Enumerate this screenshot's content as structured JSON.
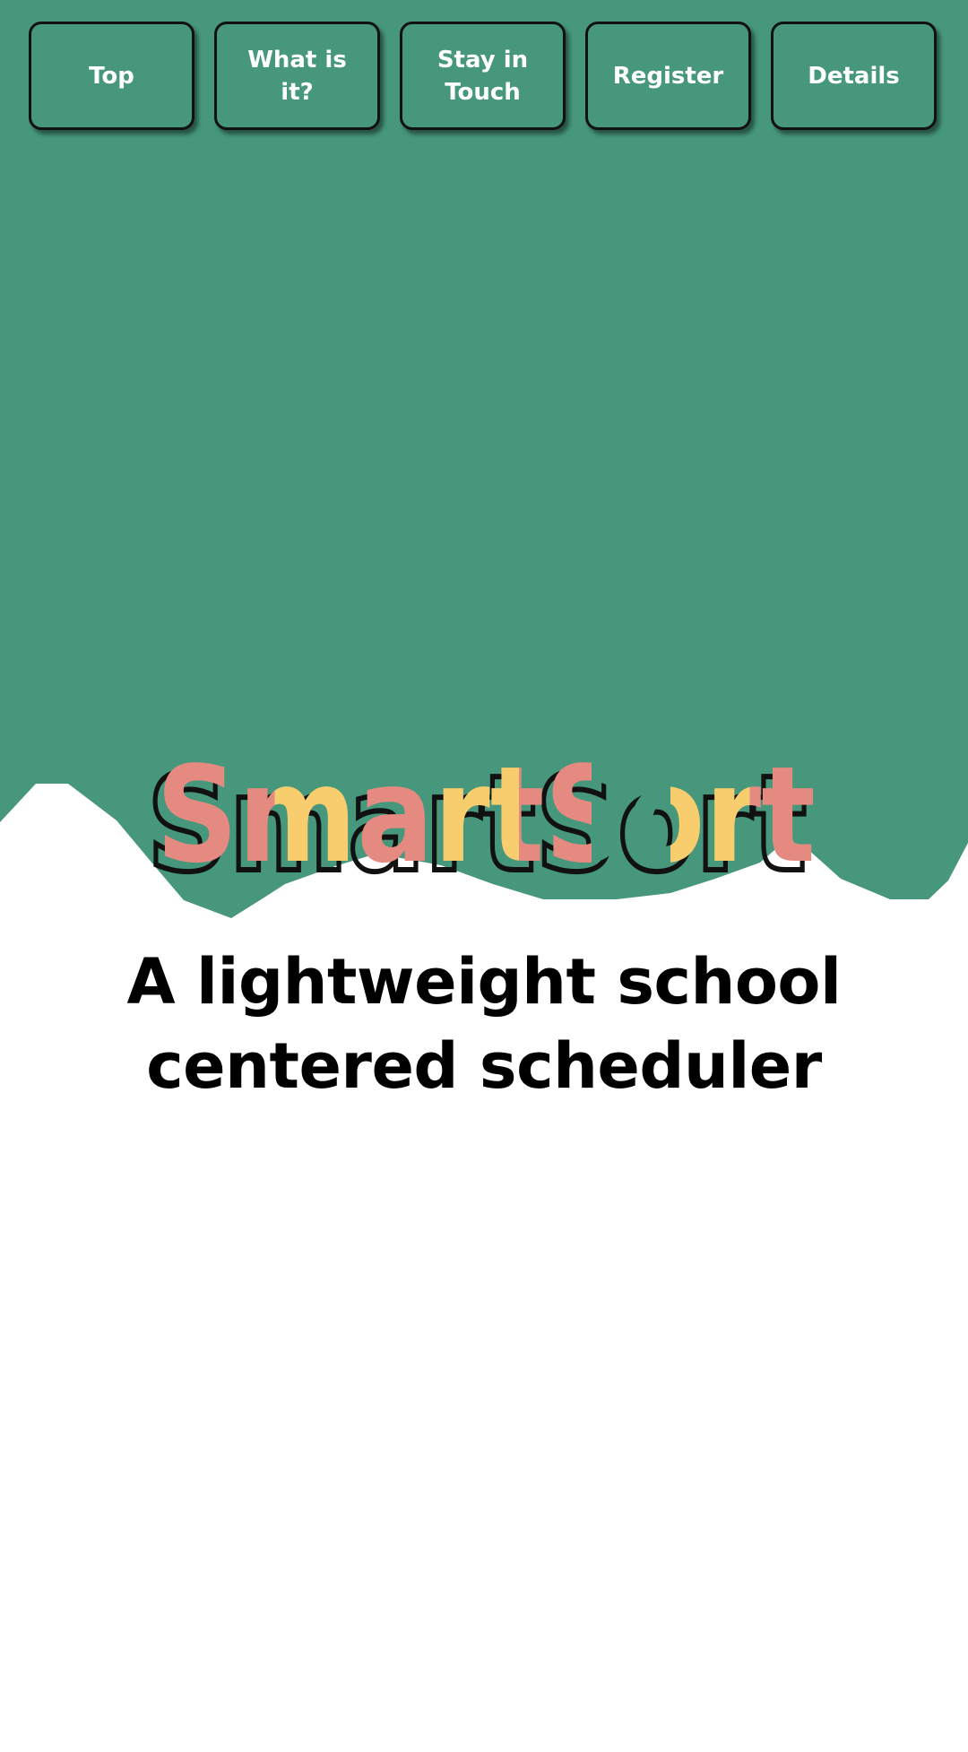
{
  "nav": {
    "items": [
      {
        "label": "Top"
      },
      {
        "label": "What is it?"
      },
      {
        "label": "Stay in Touch"
      },
      {
        "label": "Register"
      },
      {
        "label": "Details"
      }
    ]
  },
  "hero": {
    "brand_name": "SmartSort",
    "tagline": "A lightweight school centered scheduler"
  },
  "colors": {
    "hero_green": "#46977b",
    "brand_pink": "#e58a80",
    "brand_yellow": "#f7cd6e",
    "outline_black": "#111111",
    "page_white": "#ffffff"
  }
}
